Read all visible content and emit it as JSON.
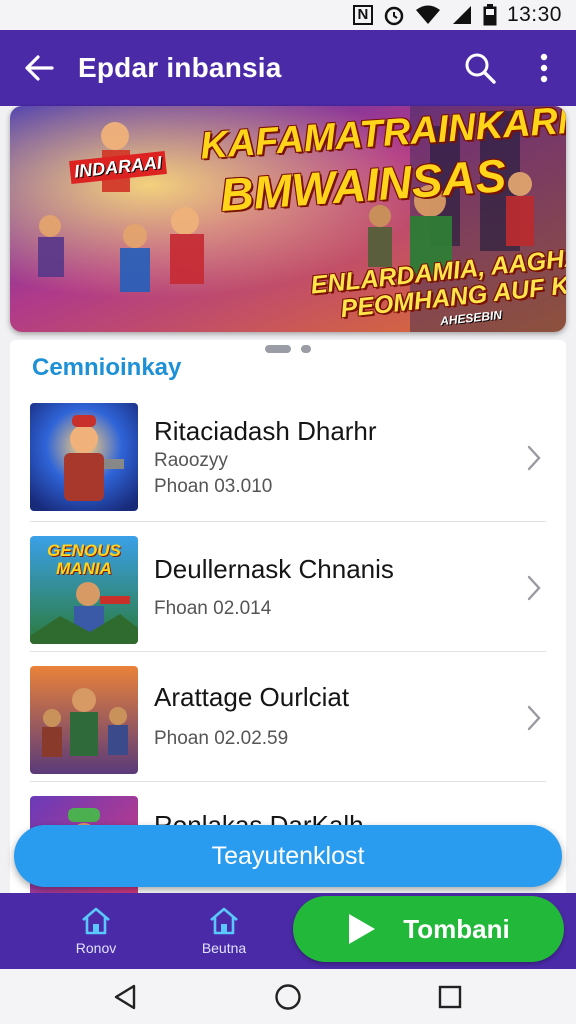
{
  "status_bar": {
    "time": "13:30",
    "icons": [
      "n-icon",
      "alarm-icon",
      "wifi-icon",
      "signal-icon",
      "battery-icon"
    ]
  },
  "app_bar": {
    "title": "Epdar inbansia",
    "back_icon": "back-arrow-icon",
    "search_icon": "search-icon",
    "menu_icon": "more-vert-icon"
  },
  "banner": {
    "headline_1": "KAFAMATRAINKARM",
    "headline_2": "BMWAINSAS",
    "subline_1": "ENLARDAMIA, AAGHAIM",
    "subline_2": "PEOMHANG AUF KAIR",
    "small_text": "AHESEBIN",
    "badge": "INDARAAI"
  },
  "carousel": {
    "pages": 2,
    "active": 0
  },
  "list": {
    "section_title": "Cemnioinkay",
    "games": [
      {
        "title": "Ritaciadash Dharhr",
        "meta": "Raoozyy",
        "price": "Phoan 03.010",
        "thumb_label": ""
      },
      {
        "title": "Deullernask Chnanis",
        "meta": "",
        "price": "Fhoan 02.014",
        "thumb_label": "GENOUS MANIA"
      },
      {
        "title": "Arattage Ourlciat",
        "meta": "",
        "price": "Phoan 02.02.59",
        "thumb_label": ""
      },
      {
        "title": "Ronlakas DarKalh",
        "meta": "",
        "price": "",
        "thumb_label": ""
      }
    ]
  },
  "fab": {
    "label": "Teayutenklost"
  },
  "bottom_nav": {
    "items": [
      {
        "label": "Ronov",
        "icon": "home-icon"
      },
      {
        "label": "Beutna",
        "icon": "home-icon"
      }
    ],
    "play_button": {
      "label": "Tombani",
      "icon": "play-icon"
    }
  },
  "system_nav": {
    "back_icon": "back-triangle-icon",
    "home_icon": "home-circle-icon",
    "recents_icon": "recents-square-icon"
  },
  "colors": {
    "primary": "#4b2aa8",
    "accent_blue": "#2a9cf0",
    "accent_green": "#22b83a",
    "section_title": "#1e90d6"
  }
}
